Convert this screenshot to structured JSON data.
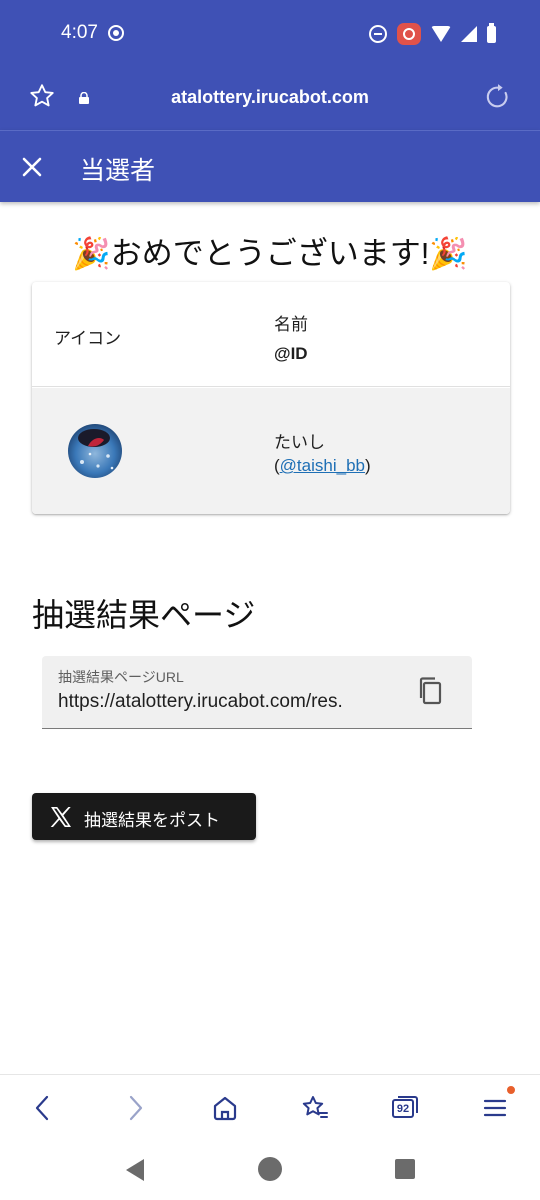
{
  "status_bar": {
    "time": "4:07"
  },
  "browser": {
    "url": "atalottery.irucabot.com",
    "tab_count": "92"
  },
  "app_bar": {
    "title": "当選者"
  },
  "winner_section": {
    "congrats_text": "🎉おめでとうございます!🎉",
    "table": {
      "header_icon": "アイコン",
      "header_name": "名前",
      "header_id": "@ID"
    },
    "winner": {
      "name": "たいし",
      "id_open": "(",
      "id_link": "@taishi_bb",
      "id_close": ")"
    }
  },
  "result_section": {
    "heading": "抽選結果ページ",
    "url_field_label": "抽選結果ページURL",
    "url_field_value": "https://atalottery.irucabot.com/res."
  },
  "post_button": {
    "label": "抽選結果をポスト"
  },
  "colors": {
    "primary": "#3f51b5",
    "link": "#1e6fb5",
    "post_button_bg": "#1a1a1a",
    "notification_dot": "#e8602c"
  },
  "icons": [
    "sync-icon",
    "dnd-icon",
    "screen-record-icon",
    "wifi-icon",
    "signal-icon",
    "battery-icon",
    "star-icon",
    "lock-icon",
    "reload-icon",
    "close-icon",
    "copy-icon",
    "x-logo-icon",
    "back-icon",
    "forward-icon",
    "home-icon",
    "bookmarks-icon",
    "tabs-icon",
    "menu-icon"
  ]
}
